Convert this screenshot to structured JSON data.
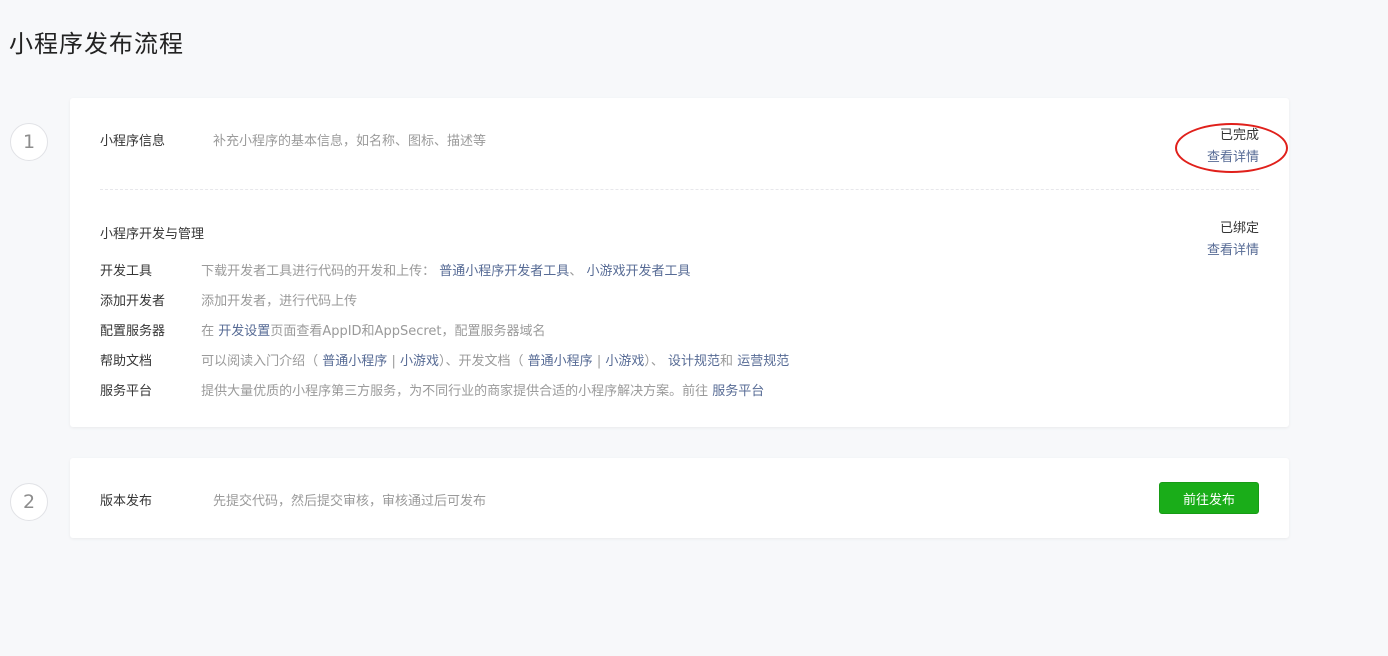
{
  "page": {
    "title": "小程序发布流程"
  },
  "steps": [
    {
      "number": "1"
    },
    {
      "number": "2"
    }
  ],
  "info": {
    "label": "小程序信息",
    "desc": "补充小程序的基本信息，如名称、图标、描述等",
    "status": "已完成",
    "detail": "查看详情"
  },
  "dev": {
    "label": "小程序开发与管理",
    "status": "已绑定",
    "detail": "查看详情",
    "tools": {
      "key": "开发工具",
      "text": "下载开发者工具进行代码的开发和上传：",
      "link1": "普通小程序开发者工具",
      "sep": "、",
      "link2": "小游戏开发者工具"
    },
    "add_dev": {
      "key": "添加开发者",
      "text": "添加开发者，进行代码上传"
    },
    "server": {
      "key": "配置服务器",
      "pre": "在",
      "link": "开发设置",
      "post": "页面查看AppID和AppSecret，配置服务器域名"
    },
    "docs": {
      "key": "帮助文档",
      "t1": "可以阅读入门介绍（",
      "l1": "普通小程序",
      "bar1": "|",
      "l2": "小游戏",
      "t2": "）、开发文档（",
      "l3": "普通小程序",
      "bar2": "|",
      "l4": "小游戏",
      "t3": "）、",
      "l5": "设计规范",
      "t4": "和",
      "l6": "运营规范"
    },
    "platform": {
      "key": "服务平台",
      "text": "提供大量优质的小程序第三方服务，为不同行业的商家提供合适的小程序解决方案。前往",
      "link": "服务平台"
    }
  },
  "release": {
    "label": "版本发布",
    "desc": "先提交代码，然后提交审核，审核通过后可发布",
    "button": "前往发布"
  },
  "colors": {
    "link": "#576b95",
    "primary_button": "#1aad19",
    "annotation": "#e0201b"
  }
}
